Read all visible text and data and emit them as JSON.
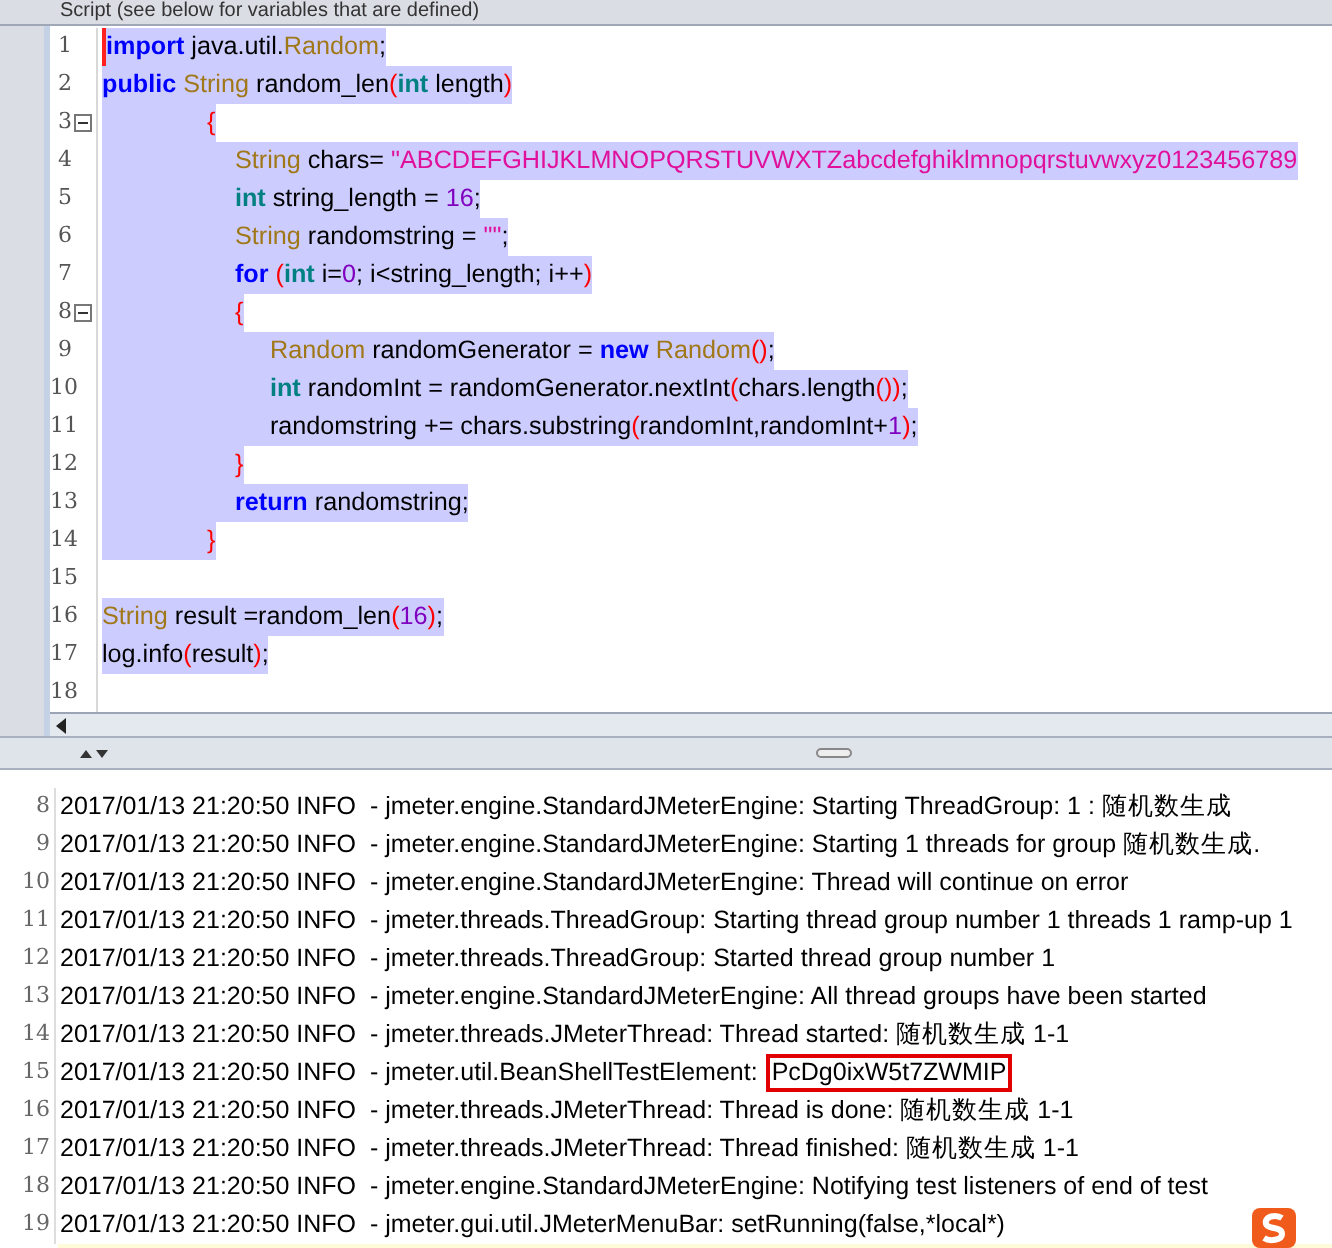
{
  "panel_title": "Script (see below for variables that are defined)",
  "code_lines": [
    {
      "number": "1",
      "fold": false,
      "selected": true,
      "tokens": [
        {
          "kind": "keyword",
          "text": "import"
        },
        {
          "kind": "plain",
          "text": " java.util."
        },
        {
          "kind": "type",
          "text": "Random"
        },
        {
          "kind": "plain",
          "text": ";"
        }
      ]
    },
    {
      "number": "2",
      "fold": false,
      "selected": true,
      "tokens": [
        {
          "kind": "keyword",
          "text": "public"
        },
        {
          "kind": "type",
          "text": " String"
        },
        {
          "kind": "plain",
          "text": " random_len"
        },
        {
          "kind": "paren",
          "text": "("
        },
        {
          "kind": "prim",
          "text": "int"
        },
        {
          "kind": "plain",
          "text": " length"
        },
        {
          "kind": "paren",
          "text": ")"
        }
      ]
    },
    {
      "number": "3",
      "fold": true,
      "selected": true,
      "tokens": [
        {
          "kind": "paren",
          "text": "               {"
        }
      ]
    },
    {
      "number": "4",
      "fold": false,
      "selected": true,
      "tokens": [
        {
          "kind": "type",
          "text": "                   String"
        },
        {
          "kind": "plain",
          "text": " chars= "
        },
        {
          "kind": "string",
          "text": "\"ABCDEFGHIJKLMNOPQRSTUVWXTZabcdefghiklmnopqrstuvwxyz0123456789"
        }
      ]
    },
    {
      "number": "5",
      "fold": false,
      "selected": true,
      "tokens": [
        {
          "kind": "prim",
          "text": "                   int"
        },
        {
          "kind": "plain",
          "text": " string_length = "
        },
        {
          "kind": "number",
          "text": "16"
        },
        {
          "kind": "plain",
          "text": ";"
        }
      ]
    },
    {
      "number": "6",
      "fold": false,
      "selected": true,
      "tokens": [
        {
          "kind": "type",
          "text": "                   String"
        },
        {
          "kind": "plain",
          "text": " randomstring = "
        },
        {
          "kind": "string",
          "text": "\"\""
        },
        {
          "kind": "plain",
          "text": ";"
        }
      ]
    },
    {
      "number": "7",
      "fold": false,
      "selected": true,
      "tokens": [
        {
          "kind": "keyword",
          "text": "                   for"
        },
        {
          "kind": "paren",
          "text": " ("
        },
        {
          "kind": "prim",
          "text": "int"
        },
        {
          "kind": "plain",
          "text": " i="
        },
        {
          "kind": "number",
          "text": "0"
        },
        {
          "kind": "plain",
          "text": "; i<string_length; i++"
        },
        {
          "kind": "paren",
          "text": ")"
        }
      ]
    },
    {
      "number": "8",
      "fold": true,
      "selected": true,
      "tokens": [
        {
          "kind": "paren",
          "text": "                   {"
        }
      ]
    },
    {
      "number": "9",
      "fold": false,
      "selected": true,
      "tokens": [
        {
          "kind": "type",
          "text": "                        Random"
        },
        {
          "kind": "plain",
          "text": " randomGenerator = "
        },
        {
          "kind": "keyword",
          "text": "new"
        },
        {
          "kind": "type",
          "text": " Random"
        },
        {
          "kind": "paren",
          "text": "()"
        },
        {
          "kind": "plain",
          "text": ";"
        }
      ]
    },
    {
      "number": "10",
      "fold": false,
      "selected": true,
      "tokens": [
        {
          "kind": "prim",
          "text": "                        int"
        },
        {
          "kind": "plain",
          "text": " randomInt = randomGenerator.nextInt"
        },
        {
          "kind": "paren",
          "text": "("
        },
        {
          "kind": "plain",
          "text": "chars.length"
        },
        {
          "kind": "paren",
          "text": "())"
        },
        {
          "kind": "plain",
          "text": ";"
        }
      ]
    },
    {
      "number": "11",
      "fold": false,
      "selected": true,
      "tokens": [
        {
          "kind": "plain",
          "text": "                        randomstring += chars.substring"
        },
        {
          "kind": "paren",
          "text": "("
        },
        {
          "kind": "plain",
          "text": "randomInt,randomInt+"
        },
        {
          "kind": "number",
          "text": "1"
        },
        {
          "kind": "paren",
          "text": ")"
        },
        {
          "kind": "plain",
          "text": ";"
        }
      ]
    },
    {
      "number": "12",
      "fold": false,
      "selected": true,
      "tokens": [
        {
          "kind": "paren",
          "text": "                   }"
        }
      ]
    },
    {
      "number": "13",
      "fold": false,
      "selected": true,
      "tokens": [
        {
          "kind": "keyword",
          "text": "                   return"
        },
        {
          "kind": "plain",
          "text": " randomstring;"
        }
      ]
    },
    {
      "number": "14",
      "fold": false,
      "selected": true,
      "tokens": [
        {
          "kind": "paren",
          "text": "               }"
        }
      ]
    },
    {
      "number": "15",
      "fold": false,
      "selected": false
    },
    {
      "number": "16",
      "fold": false,
      "selected": true,
      "tokens": [
        {
          "kind": "type",
          "text": "String"
        },
        {
          "kind": "plain",
          "text": " result =random_len"
        },
        {
          "kind": "paren",
          "text": "("
        },
        {
          "kind": "number",
          "text": "16"
        },
        {
          "kind": "paren",
          "text": ")"
        },
        {
          "kind": "plain",
          "text": ";"
        }
      ]
    },
    {
      "number": "17",
      "fold": false,
      "selected": true,
      "tokens": [
        {
          "kind": "plain",
          "text": "log.info"
        },
        {
          "kind": "paren",
          "text": "("
        },
        {
          "kind": "plain",
          "text": "result"
        },
        {
          "kind": "paren",
          "text": ")"
        },
        {
          "kind": "plain",
          "text": ";"
        }
      ]
    },
    {
      "number": "18",
      "fold": false,
      "selected": false
    }
  ],
  "log_lines": [
    {
      "number": "8",
      "text": "2017/01/13 21:20:50 INFO  - jmeter.engine.StandardJMeterEngine: Starting ThreadGroup: 1 : 随机数生成"
    },
    {
      "number": "9",
      "text": "2017/01/13 21:20:50 INFO  - jmeter.engine.StandardJMeterEngine: Starting 1 threads for group 随机数生成."
    },
    {
      "number": "10",
      "text": "2017/01/13 21:20:50 INFO  - jmeter.engine.StandardJMeterEngine: Thread will continue on error"
    },
    {
      "number": "11",
      "text": "2017/01/13 21:20:50 INFO  - jmeter.threads.ThreadGroup: Starting thread group number 1 threads 1 ramp-up 1"
    },
    {
      "number": "12",
      "text": "2017/01/13 21:20:50 INFO  - jmeter.threads.ThreadGroup: Started thread group number 1"
    },
    {
      "number": "13",
      "text": "2017/01/13 21:20:50 INFO  - jmeter.engine.StandardJMeterEngine: All thread groups have been started"
    },
    {
      "number": "14",
      "text": "2017/01/13 21:20:50 INFO  - jmeter.threads.JMeterThread: Thread started: 随机数生成 1-1"
    },
    {
      "number": "15",
      "text": "2017/01/13 21:20:50 INFO  - jmeter.util.BeanShellTestElement:",
      "boxed": "PcDg0ixW5t7ZWMIP"
    },
    {
      "number": "16",
      "text": "2017/01/13 21:20:50 INFO  - jmeter.threads.JMeterThread: Thread is done: 随机数生成 1-1"
    },
    {
      "number": "17",
      "text": "2017/01/13 21:20:50 INFO  - jmeter.threads.JMeterThread: Thread finished: 随机数生成 1-1"
    },
    {
      "number": "18",
      "text": "2017/01/13 21:20:50 INFO  - jmeter.engine.StandardJMeterEngine: Notifying test listeners of end of test"
    },
    {
      "number": "19",
      "text": "2017/01/13 21:20:50 INFO  - jmeter.gui.util.JMeterMenuBar: setRunning(false,*local*)"
    }
  ]
}
